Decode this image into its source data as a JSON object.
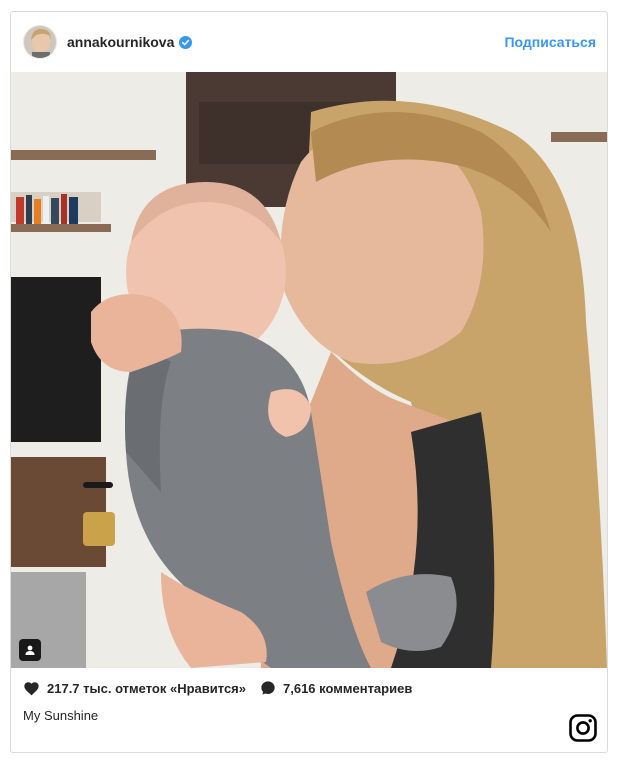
{
  "post": {
    "username": "annakournikova",
    "follow_label": "Подписаться",
    "likes_text": "217.7 тыс. отметок «Нравится»",
    "comments_text": "7,616 комментариев",
    "caption": "My Sunshine"
  },
  "icons": {
    "verified": "verified-badge-icon",
    "heart": "heart-icon",
    "comment": "comment-icon",
    "tag": "user-tag-icon",
    "logo": "instagram-logo-icon"
  },
  "colors": {
    "accent": "#3897f0",
    "border": "#dbdbdb",
    "text": "#262626"
  }
}
